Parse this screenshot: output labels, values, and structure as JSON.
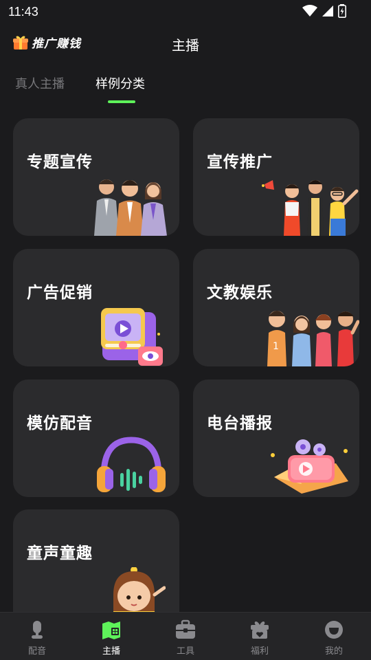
{
  "status_bar": {
    "time": "11:43"
  },
  "header": {
    "promo_label": "推广赚钱",
    "title": "主播"
  },
  "tabs": [
    {
      "label": "真人主播",
      "active": false
    },
    {
      "label": "样例分类",
      "active": true
    }
  ],
  "categories": [
    {
      "title": "专题宣传",
      "art": "business-team"
    },
    {
      "title": "宣传推广",
      "art": "promotion-crowd"
    },
    {
      "title": "广告促销",
      "art": "video-ad"
    },
    {
      "title": "文教娱乐",
      "art": "kids-group"
    },
    {
      "title": "模仿配音",
      "art": "headphones"
    },
    {
      "title": "电台播报",
      "art": "film-reel-box"
    },
    {
      "title": "童声童趣",
      "art": "little-girl"
    }
  ],
  "bottom_nav": [
    {
      "label": "配音",
      "icon": "microphone-icon",
      "active": false
    },
    {
      "label": "主播",
      "icon": "anchor-icon",
      "active": true
    },
    {
      "label": "工具",
      "icon": "toolbox-icon",
      "active": false
    },
    {
      "label": "福利",
      "icon": "gift-icon",
      "active": false
    },
    {
      "label": "我的",
      "icon": "profile-icon",
      "active": false
    }
  ],
  "colors": {
    "accent": "#5ef25a",
    "background": "#1b1b1d",
    "card": "#2b2b2d",
    "tabbar": "#252527"
  }
}
